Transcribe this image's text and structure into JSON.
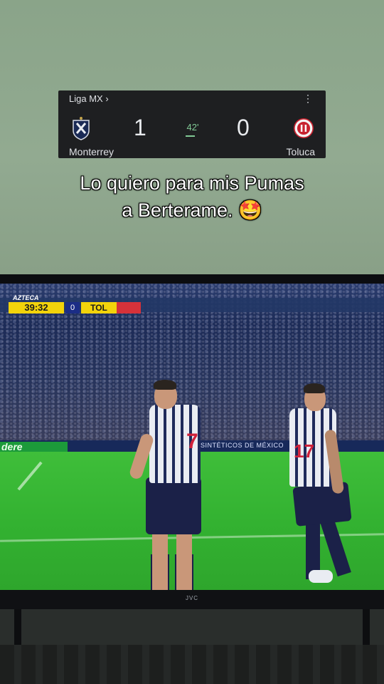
{
  "scorecard": {
    "league": "Liga MX",
    "league_chevron": "›",
    "menu_icon": "⋮",
    "home_team": "Monterrey",
    "away_team": "Toluca",
    "home_score": "1",
    "away_score": "0",
    "minute": "42'",
    "accent_color": "#81c995"
  },
  "caption": {
    "line1": "Lo quiero para mis Pumas",
    "line2": "a Berterame. 🤩"
  },
  "broadcast": {
    "channel": "AZTECA",
    "clock": "39:32",
    "score_dot": "0",
    "team_abbr": "TOL",
    "ad_left": "dere",
    "ad_sponsor": "SINTÉTICOS DE MÉXICO"
  },
  "players": {
    "left_number": "7",
    "right_number": "17"
  },
  "tv": {
    "brand": "JVC"
  }
}
